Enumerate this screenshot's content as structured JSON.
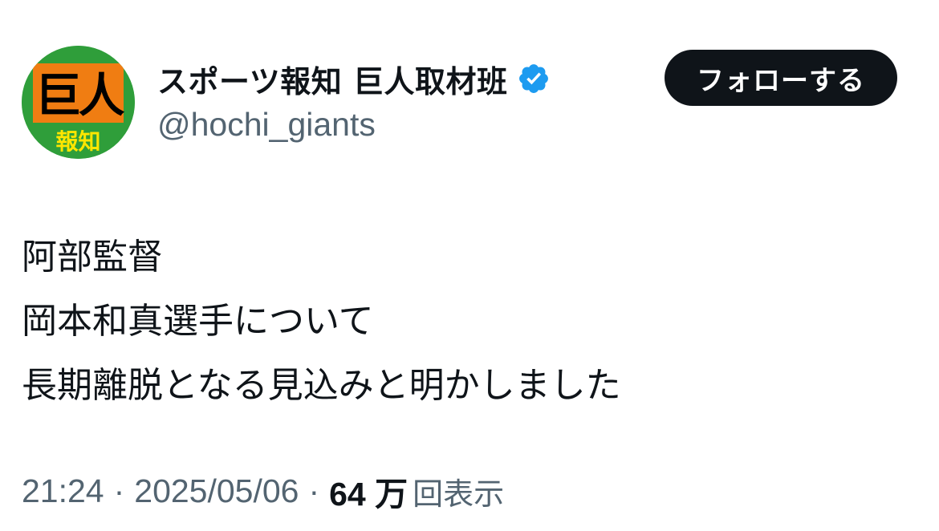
{
  "account": {
    "display_name": "スポーツ報知 巨人取材班",
    "handle": "@hochi_giants",
    "verified": true,
    "avatar": {
      "main_text": "巨人",
      "sub_text": "報知",
      "colors": {
        "ring": "#2f9e3a",
        "field": "#f07d12",
        "text": "#000000",
        "sub_text": "#ffe600"
      }
    }
  },
  "follow_button": {
    "label": "フォローする"
  },
  "tweet": {
    "lines": [
      "阿部監督",
      "岡本和真選手について",
      "長期離脱となる見込みと明かしました"
    ]
  },
  "meta": {
    "time": "21:24",
    "separator": "·",
    "date": "2025/05/06",
    "views_count": "64 万",
    "views_label": "回表示"
  },
  "colors": {
    "text_primary": "#0f1419",
    "text_secondary": "#536471",
    "verified_badge": "#1d9bf0",
    "button_bg": "#0f1419"
  }
}
